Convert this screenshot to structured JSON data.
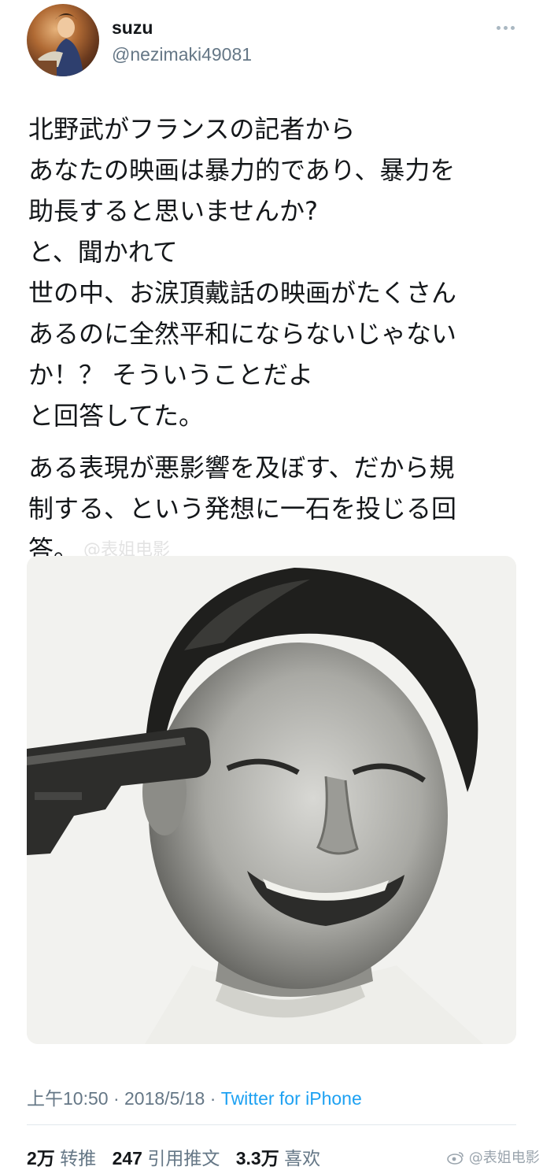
{
  "user": {
    "display_name": "suzu",
    "username": "@nezimaki49081"
  },
  "tweet": {
    "lines_para1": [
      "北野武がフランスの記者から",
      "あなたの映画は暴力的であり、暴力を",
      "助長すると思いませんか?",
      "と、聞かれて",
      "世の中、お涙頂戴話の映画がたくさん",
      "あるのに全然平和にならないじゃない",
      "か！？ そういうことだよ",
      "と回答してた。"
    ],
    "lines_para2": [
      "ある表現が悪影響を及ぼす、だから規",
      "制する、という発想に一石を投じる回",
      "答。"
    ],
    "inline_watermark": "@表姐电影"
  },
  "meta": {
    "time": "上午10:50",
    "sep1": " · ",
    "date": "2018/5/18",
    "sep2": " · ",
    "source": "Twitter for iPhone"
  },
  "stats": {
    "retweets_count": "2万",
    "retweets_label": "转推",
    "quotes_count": "247",
    "quotes_label": "引用推文",
    "likes_count": "3.3万",
    "likes_label": "喜欢"
  },
  "weibo_watermark": "@表姐电影",
  "icons": {
    "more": "more-dots-icon",
    "weibo": "weibo-logo-icon"
  },
  "colors": {
    "text": "#14171a",
    "secondary": "#657786",
    "link": "#1da1f2"
  }
}
